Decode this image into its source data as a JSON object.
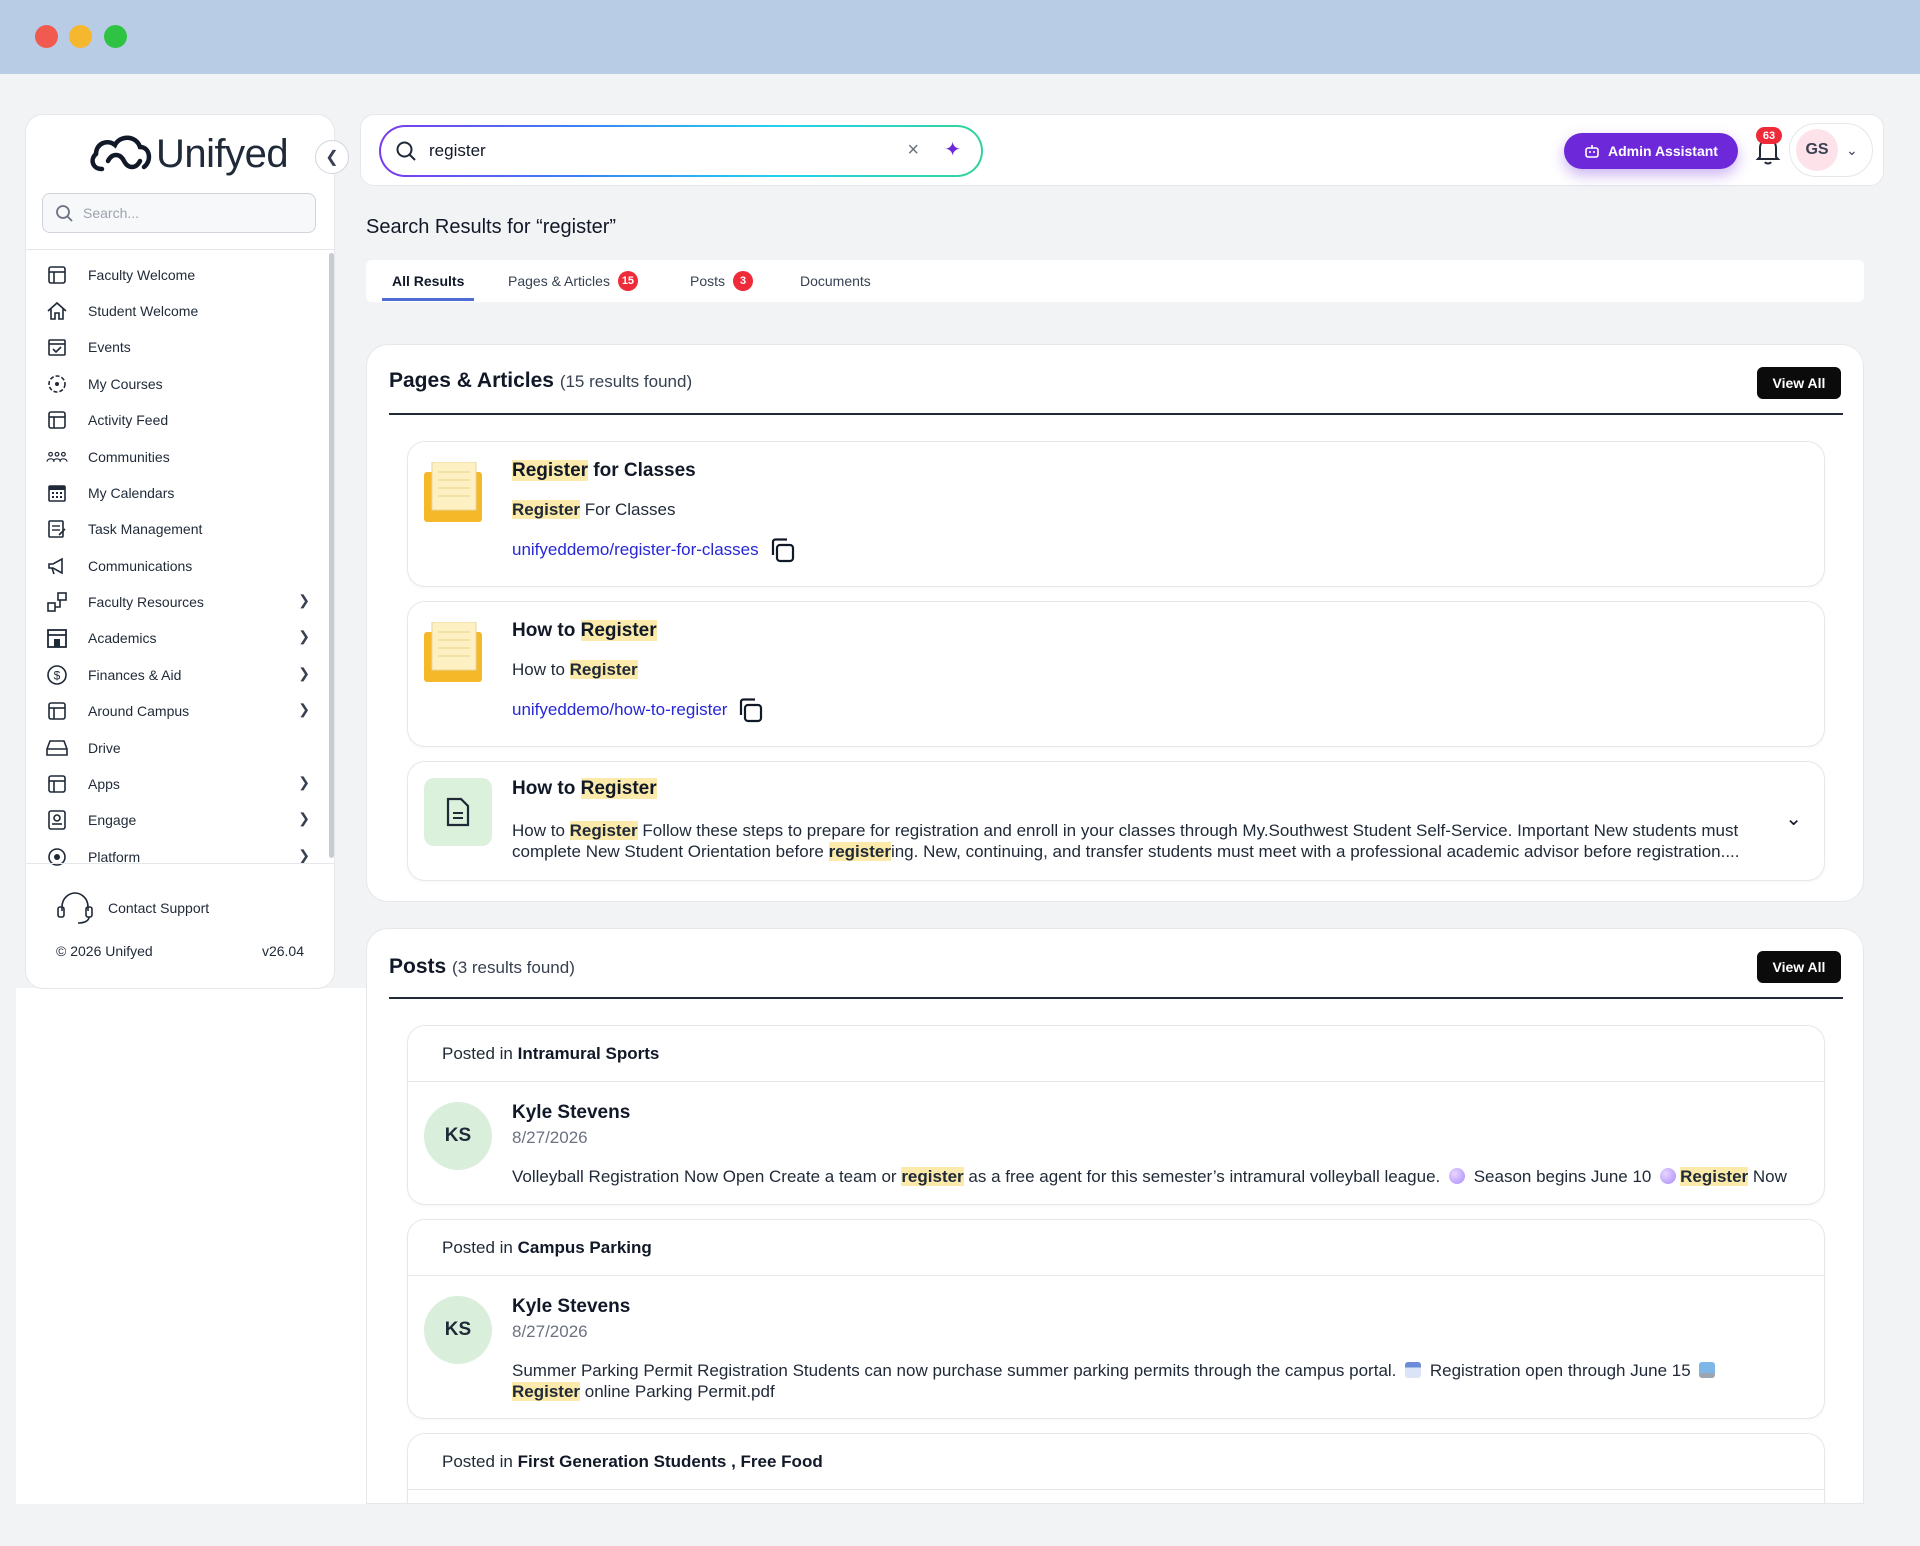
{
  "window": {
    "controls": [
      "close",
      "minimize",
      "maximize"
    ],
    "colors": {
      "close": "#f05a4f",
      "minimize": "#f5b72e",
      "maximize": "#2fc343"
    }
  },
  "brand": {
    "name": "Unifyed",
    "accent": "#6d28d9"
  },
  "sidebar": {
    "search_placeholder": "Search...",
    "items": [
      {
        "label": "Faculty Welcome",
        "icon": "layout-icon"
      },
      {
        "label": "Student Welcome",
        "icon": "home-icon"
      },
      {
        "label": "Events",
        "icon": "calendar-check-icon"
      },
      {
        "label": "My Courses",
        "icon": "course-wheel-icon"
      },
      {
        "label": "Activity Feed",
        "icon": "layout-icon"
      },
      {
        "label": "Communities",
        "icon": "people-group-icon"
      },
      {
        "label": "My Calendars",
        "icon": "calendar-grid-icon"
      },
      {
        "label": "Task Management",
        "icon": "task-list-icon"
      },
      {
        "label": "Communications",
        "icon": "megaphone-icon"
      },
      {
        "label": "Faculty Resources",
        "icon": "resources-icon",
        "expandable": true
      },
      {
        "label": "Academics",
        "icon": "building-icon",
        "expandable": true
      },
      {
        "label": "Finances & Aid",
        "icon": "dollar-circle-icon",
        "expandable": true
      },
      {
        "label": "Around Campus",
        "icon": "layout-icon",
        "expandable": true
      },
      {
        "label": "Drive",
        "icon": "drive-icon"
      },
      {
        "label": "Apps",
        "icon": "layout-icon",
        "expandable": true
      },
      {
        "label": "Engage",
        "icon": "engage-icon",
        "expandable": true
      },
      {
        "label": "Platform",
        "icon": "platform-icon",
        "expandable": true
      }
    ],
    "contact": "Contact Support",
    "copyright": "© 2026 Unifyed",
    "version": "v26.04"
  },
  "header": {
    "search_value": "register",
    "admin_button": "Admin Assistant",
    "notifications": "63",
    "user_initials": "GS"
  },
  "results": {
    "title": "Search Results for “register”",
    "tabs": [
      {
        "label": "All Results",
        "active": true
      },
      {
        "label": "Pages & Articles",
        "badge": "15"
      },
      {
        "label": "Posts",
        "badge": "3"
      },
      {
        "label": "Documents"
      }
    ]
  },
  "pages": {
    "title": "Pages & Articles",
    "count": "(15 results found)",
    "view_all": "View All",
    "items": [
      {
        "title_hl": "Register",
        "title_rest": " for Classes",
        "sub_hl": "Register",
        "sub_rest": " For Classes",
        "link": "unifyeddemo/register-for-classes"
      },
      {
        "title_pre": "How to ",
        "title_hl": "Register",
        "sub_pre": "How to ",
        "sub_hl": "Register",
        "link": "unifyeddemo/how-to-register"
      },
      {
        "title_pre": "How to ",
        "title_hl": "Register",
        "body": {
          "p1": "How to ",
          "h1": "Register",
          "p2": " Follow these steps to prepare for registration and enroll in your classes through My.Southwest Student Self-Service. Important New students must complete New Student Orientation before ",
          "h2": "register",
          "p3": "ing. New, continuing, and transfer students must meet with a professional academic advisor before registration...."
        }
      }
    ]
  },
  "posts": {
    "title": "Posts",
    "count": "(3 results found)",
    "view_all": "View All",
    "posted_in": "Posted in ",
    "items": [
      {
        "group": "Intramural Sports",
        "initials": "KS",
        "author": "Kyle Stevens",
        "date": "8/27/2026",
        "b1": "Volleyball Registration Now Open Create a team or ",
        "h1": "register",
        "b2": " as a free agent for this semester’s intramural volleyball league. ",
        "b3": " Season begins June 10 ",
        "h2": "Register",
        "b4": " Now"
      },
      {
        "group": "Campus Parking",
        "initials": "KS",
        "author": "Kyle Stevens",
        "date": "8/27/2026",
        "b1": "Summer Parking Permit Registration Students can now purchase summer parking permits through the campus portal. ",
        "b2": " Registration open through June 15 ",
        "h1": "Register",
        "b3": " online Parking Permit.pdf"
      },
      {
        "group": "First Generation Students , Free Food"
      }
    ]
  }
}
